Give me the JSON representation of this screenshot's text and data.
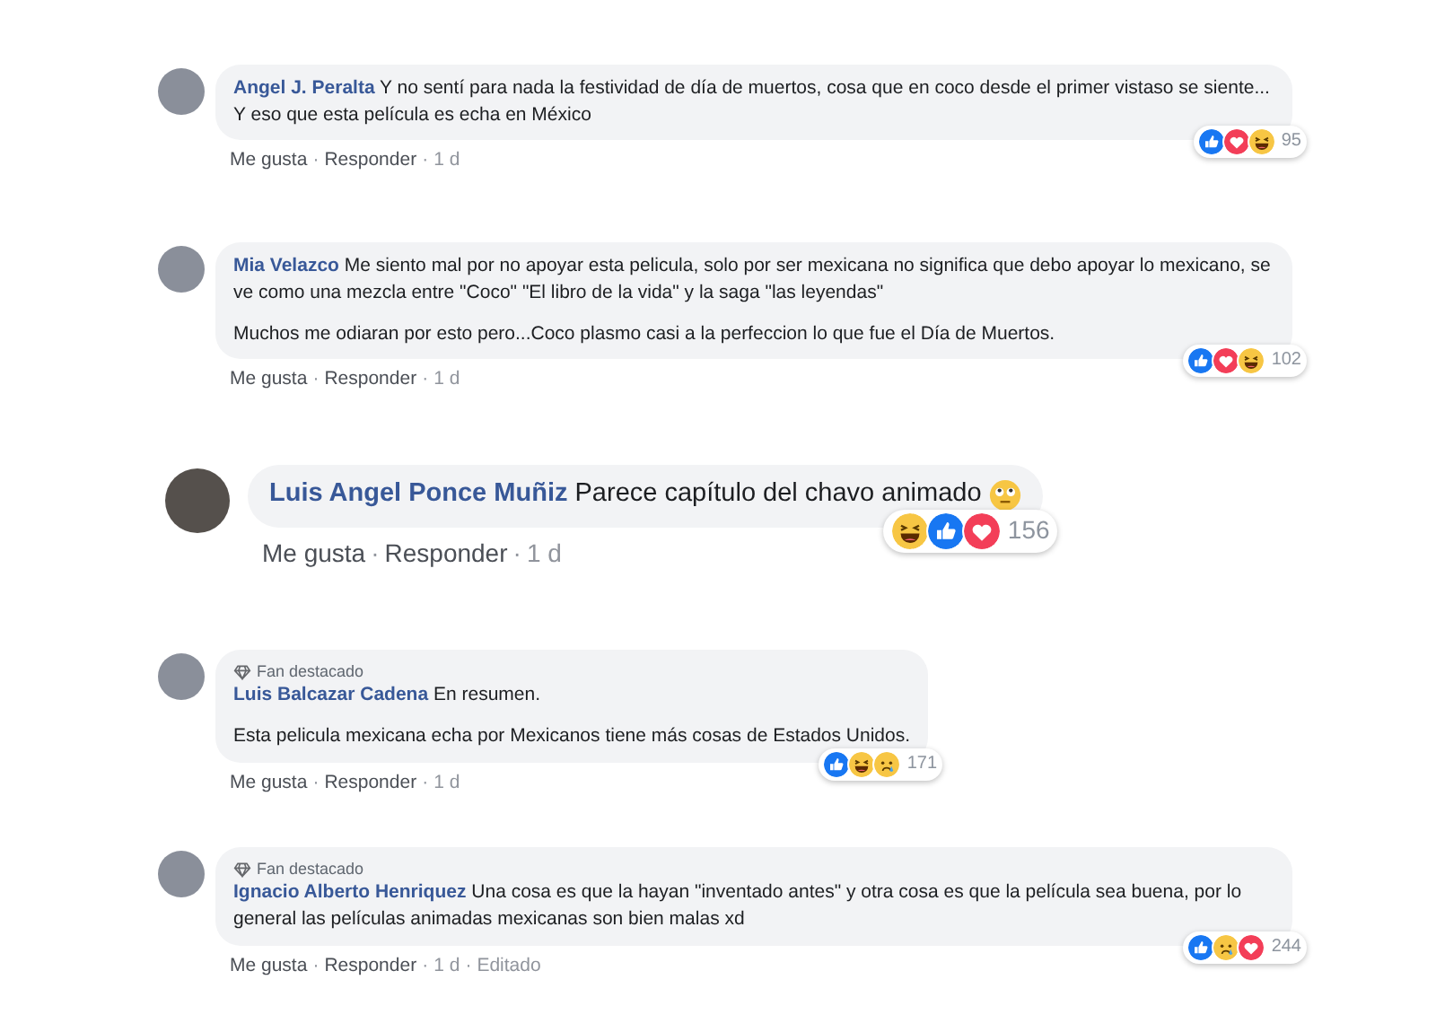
{
  "separator": "·",
  "comments": [
    {
      "kind": "normal",
      "author": "Angel J. Peralta",
      "paragraphs": [
        "Y no sentí para nada la festividad de día de muertos, cosa que en coco desde el primer vistaso se siente... Y eso que esta película es echa en México"
      ],
      "meta": [
        {
          "kind": "link",
          "text": "Me gusta"
        },
        {
          "kind": "link",
          "text": "Responder"
        },
        {
          "kind": "time",
          "text": "1 d"
        }
      ],
      "reactions": [
        {
          "kind": "like"
        },
        {
          "kind": "love"
        },
        {
          "kind": "haha"
        }
      ],
      "count": "95"
    },
    {
      "kind": "normal",
      "author": "Mia Velazco",
      "paragraphs": [
        "Me siento mal por no apoyar esta pelicula, solo por ser mexicana no significa que debo apoyar lo mexicano, se ve como una mezcla entre \"Coco\" \"El libro de la vida\" y la saga \"las leyendas\"",
        "Muchos me odiaran por esto pero...Coco plasmo casi a la perfeccion lo que fue el Día de Muertos."
      ],
      "meta": [
        {
          "kind": "link",
          "text": "Me gusta"
        },
        {
          "kind": "link",
          "text": "Responder"
        },
        {
          "kind": "time",
          "text": "1 d"
        }
      ],
      "reactions": [
        {
          "kind": "like"
        },
        {
          "kind": "love"
        },
        {
          "kind": "haha"
        }
      ],
      "count": "102"
    },
    {
      "kind": "large",
      "author": "Luis Angel Ponce Muñiz",
      "paragraphs": [
        "Parece capítulo del chavo animado"
      ],
      "trailing_emoji": true,
      "meta": [
        {
          "kind": "link",
          "text": "Me gusta"
        },
        {
          "kind": "link",
          "text": "Responder"
        },
        {
          "kind": "time",
          "text": "1 d"
        }
      ],
      "reactions": [
        {
          "kind": "haha"
        },
        {
          "kind": "like"
        },
        {
          "kind": "love"
        }
      ],
      "count": "156"
    },
    {
      "kind": "normal",
      "badge": "Fan destacado",
      "author": "Luis Balcazar Cadena",
      "paragraphs": [
        "En resumen.",
        "Esta pelicula mexicana echa por Mexicanos tiene más cosas de Estados Unidos."
      ],
      "meta": [
        {
          "kind": "link",
          "text": "Me gusta"
        },
        {
          "kind": "link",
          "text": "Responder"
        },
        {
          "kind": "time",
          "text": "1 d"
        }
      ],
      "reactions": [
        {
          "kind": "like"
        },
        {
          "kind": "haha"
        },
        {
          "kind": "sad"
        }
      ],
      "count": "171"
    },
    {
      "kind": "normal",
      "badge": "Fan destacado",
      "author": "Ignacio Alberto Henriquez",
      "paragraphs": [
        "Una cosa es que la hayan \"inventado antes\" y otra cosa es que la película sea buena, por lo general las películas animadas mexicanas son bien malas xd"
      ],
      "meta": [
        {
          "kind": "link",
          "text": "Me gusta"
        },
        {
          "kind": "link",
          "text": "Responder"
        },
        {
          "kind": "time",
          "text": "1 d"
        },
        {
          "kind": "time",
          "text": "Editado"
        }
      ],
      "reactions": [
        {
          "kind": "like"
        },
        {
          "kind": "sad"
        },
        {
          "kind": "love"
        }
      ],
      "count": "244"
    }
  ]
}
